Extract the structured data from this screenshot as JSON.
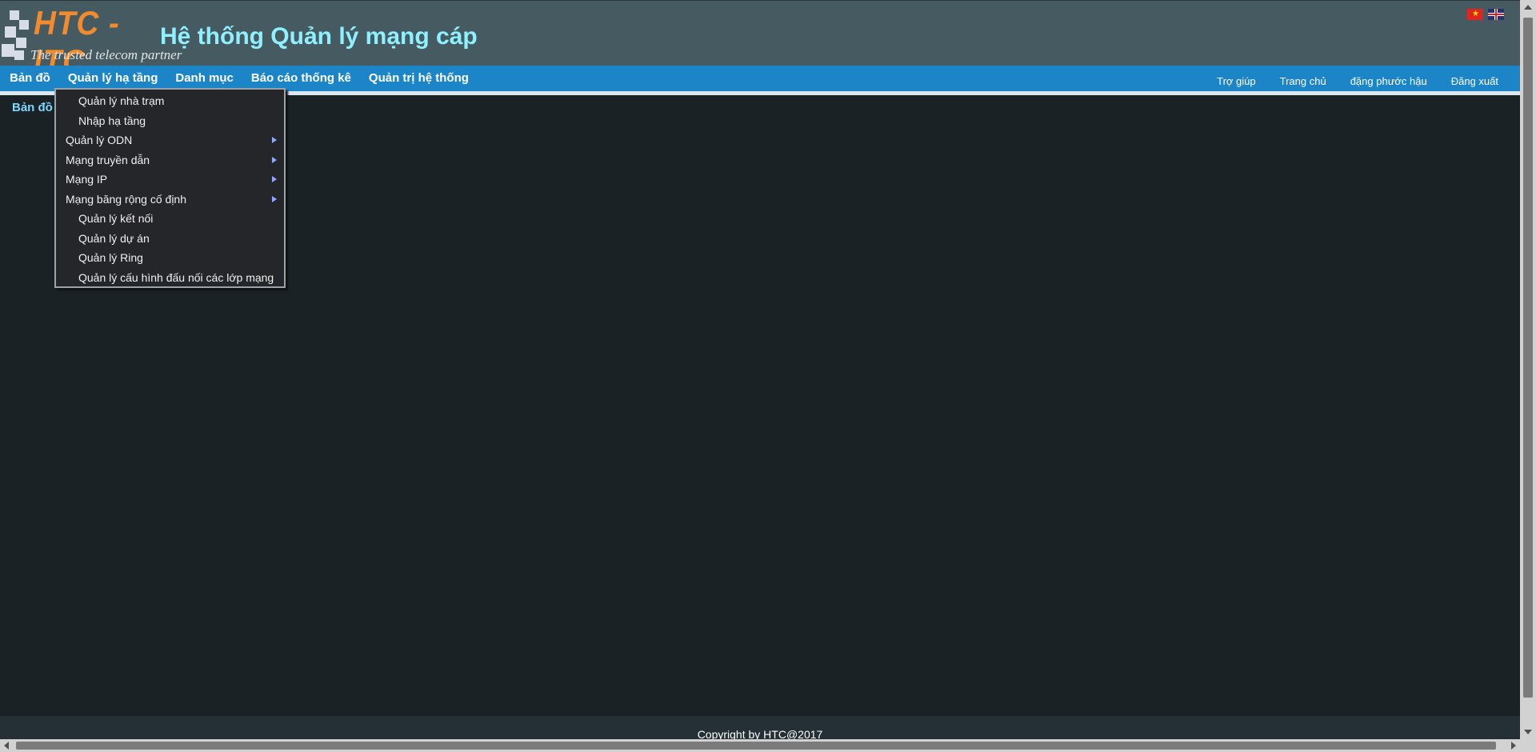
{
  "header": {
    "logo_text": "HTC - ITC",
    "logo_tagline": "The trusted telecom partner",
    "app_title": "Hệ thống Quản lý mạng cáp",
    "flags": [
      "vietnam-flag-icon",
      "uk-flag-icon"
    ]
  },
  "nav": {
    "items": [
      "Bản đồ",
      "Quản lý hạ tầng",
      "Danh mục",
      "Báo cáo thống kê",
      "Quản trị hệ thống"
    ],
    "right": [
      "Trợ giúp",
      "Trang chủ",
      "đặng phước hậu",
      "Đăng xuất"
    ]
  },
  "breadcrumb": "Bản đồ",
  "dropdown": {
    "items": [
      {
        "label": "Quản lý nhà trạm",
        "has_submenu": false
      },
      {
        "label": "Nhập hạ tầng",
        "has_submenu": false
      },
      {
        "label": "Quản lý ODN",
        "has_submenu": true
      },
      {
        "label": "Mạng truyền dẫn",
        "has_submenu": true
      },
      {
        "label": "Mạng IP",
        "has_submenu": true
      },
      {
        "label": "Mạng băng rộng cố định",
        "has_submenu": true
      },
      {
        "label": "Quản lý kết nối",
        "has_submenu": false
      },
      {
        "label": "Quản lý dự án",
        "has_submenu": false
      },
      {
        "label": "Quản lý Ring",
        "has_submenu": false
      },
      {
        "label": "Quản lý cấu hình đấu nối các lớp mạng",
        "has_submenu": false
      }
    ]
  },
  "footer": {
    "copyright": "Copyright by HTC@2017"
  },
  "colors": {
    "header_bg": "#465a61",
    "nav_bg": "#1b85c8",
    "title": "#8ff0ff",
    "logo": "#f28a2e",
    "body_bg": "#1b2225"
  }
}
